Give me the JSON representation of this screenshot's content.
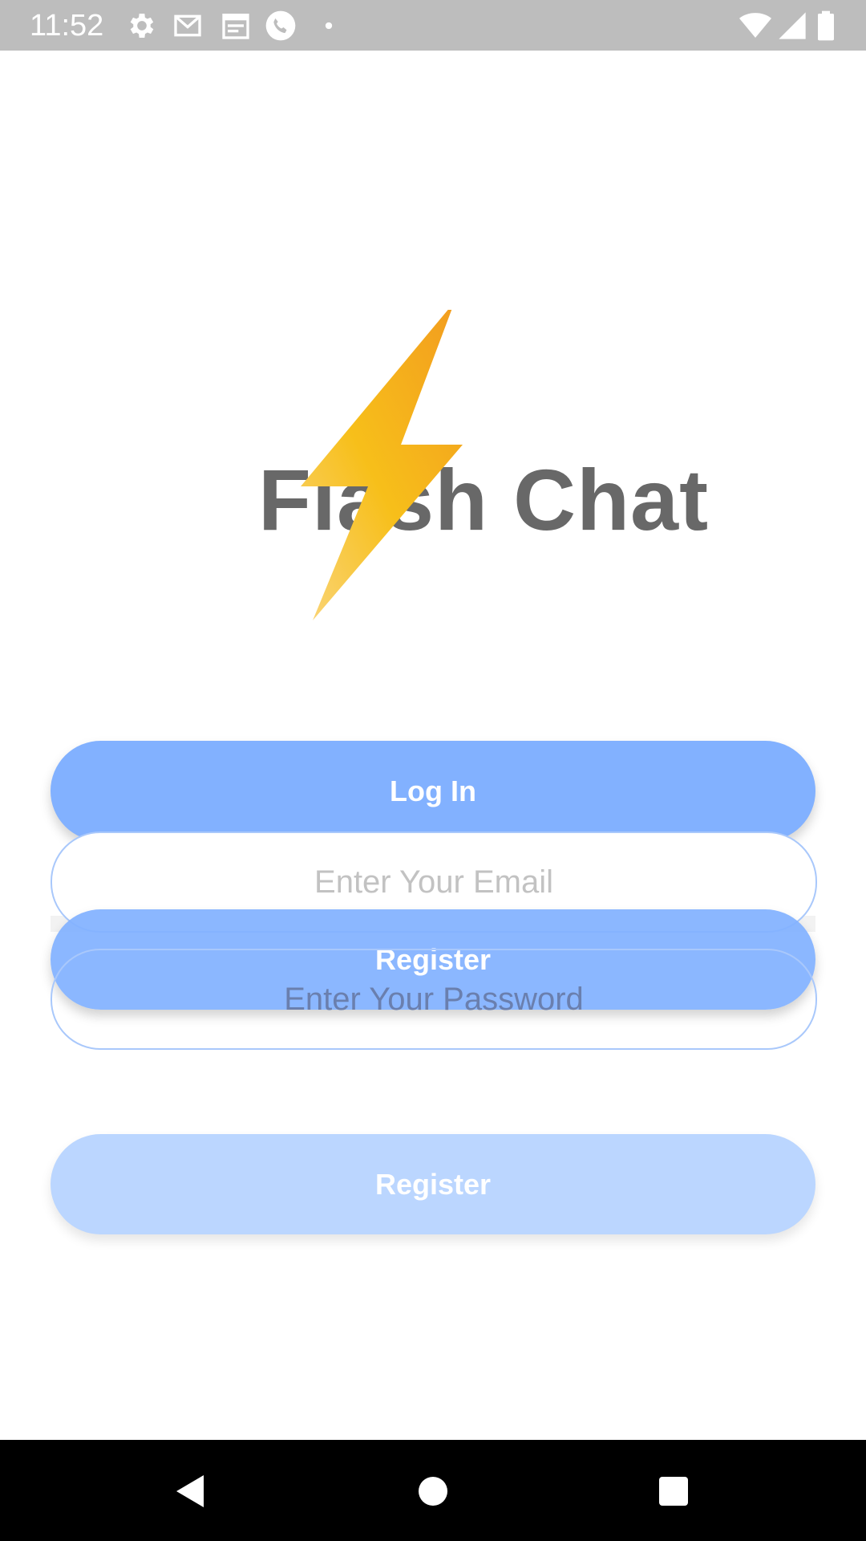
{
  "status_bar": {
    "time": "11:52",
    "icons": [
      "settings-icon",
      "gmail-icon",
      "calendar-icon",
      "phone-icon",
      "dot-icon",
      "wifi-icon",
      "signal-icon",
      "battery-icon"
    ]
  },
  "app": {
    "title": "Flash Chat",
    "logo_icon": "lightning-bolt-icon",
    "accent_color": "#82b1ff"
  },
  "login_screen": {
    "login_label": "Log In",
    "email_placeholder": "Enter Your Email",
    "register_overlay_label": "Register",
    "password_placeholder": "Enter Your Password",
    "register_label": "Register"
  },
  "nav_bar": {
    "buttons": [
      "back-icon",
      "home-icon",
      "recents-icon"
    ]
  }
}
